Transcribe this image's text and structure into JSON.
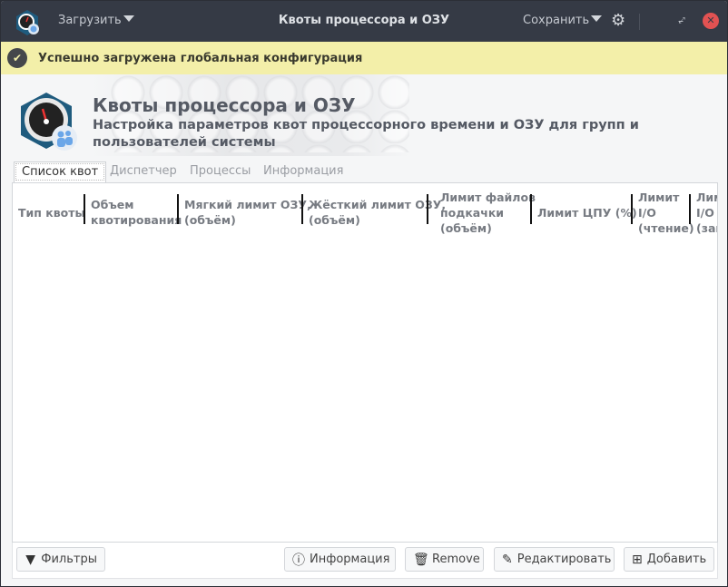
{
  "window": {
    "title": "Квоты процессора и ОЗУ",
    "load_menu": "Загрузить",
    "save_menu": "Сохранить",
    "close_color": "#e25252"
  },
  "banner": {
    "text": "Успешно загружена глобальная конфигурация",
    "color": "#f3efa9",
    "icon": "check-circle-icon"
  },
  "header": {
    "title": "Квоты процессора и ОЗУ",
    "subtitle": "Настройка параметров квот процессорного времени и ОЗУ для групп и пользователей системы"
  },
  "tabs": [
    {
      "label": "Список квот",
      "active": true
    },
    {
      "label": "Диспетчер"
    },
    {
      "label": "Процессы"
    },
    {
      "label": "Информация"
    }
  ],
  "table": {
    "columns": [
      "Тип квоты",
      "Объем\nквотирования",
      "Мягкий лимит ОЗУ,\n(объём)",
      "Жёсткий лимит ОЗУ,\n(объём)",
      "Лимит файлов\nподкачки\n(объём)",
      "Лимит ЦПУ (%)",
      "Лимит\nI/O\n(чтение)",
      "Лим\nI/O\n(зап"
    ],
    "rows": []
  },
  "toolbar": {
    "filters": "Фильтры",
    "info": "Информация",
    "remove": "Remove",
    "edit": "Редактировать",
    "add": "Добавить"
  }
}
